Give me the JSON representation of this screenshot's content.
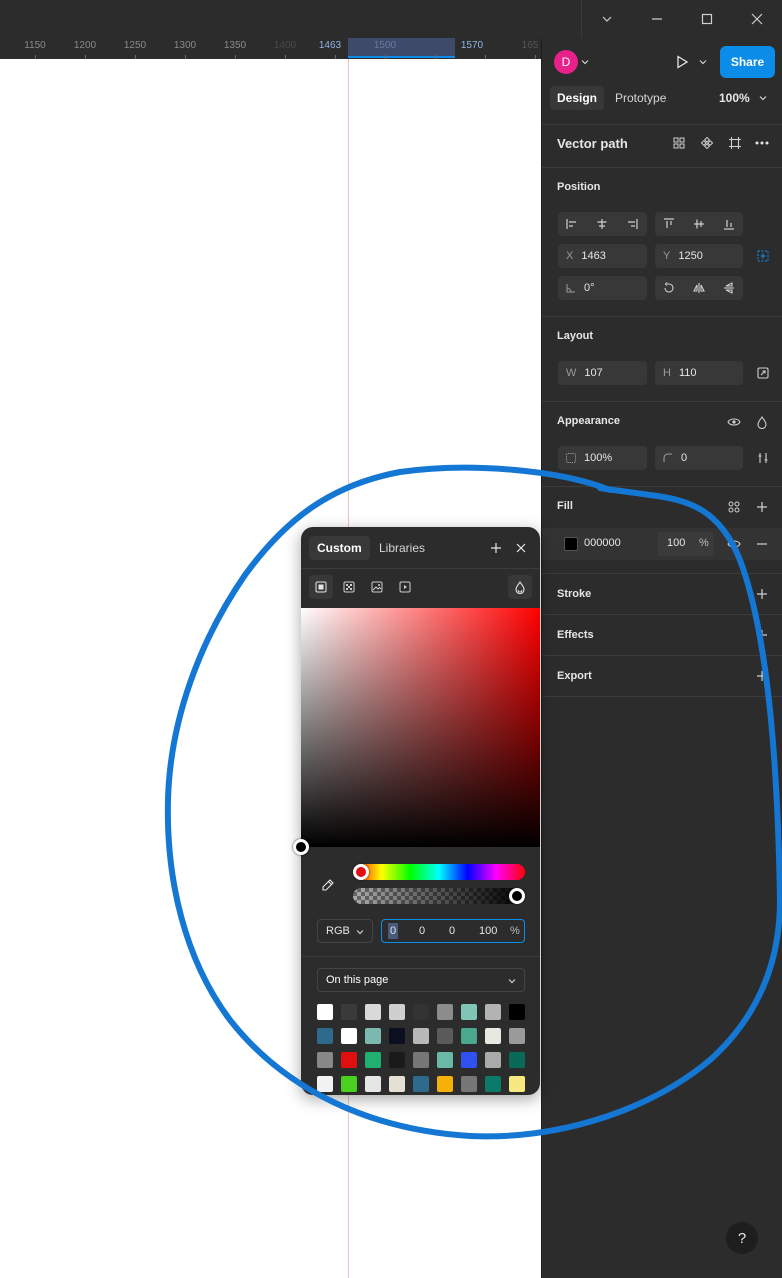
{
  "ruler": {
    "ticks": [
      "1150",
      "1200",
      "1250",
      "1300",
      "1350",
      "1400",
      "1463",
      "1500",
      "1570",
      "165"
    ],
    "sel_start": "1463",
    "sel_end": "1570"
  },
  "header": {
    "avatar_letter": "D",
    "share_label": "Share",
    "tabs": [
      "Design",
      "Prototype"
    ],
    "zoom": "100%"
  },
  "layer": {
    "name": "Vector path"
  },
  "position": {
    "title": "Position",
    "x_label": "X",
    "x": "1463",
    "y_label": "Y",
    "y": "1250",
    "rotation": "0°"
  },
  "layout": {
    "title": "Layout",
    "w_label": "W",
    "w": "107",
    "h_label": "H",
    "h": "110"
  },
  "appearance": {
    "title": "Appearance",
    "opacity": "100%",
    "radius": "0"
  },
  "fill": {
    "title": "Fill",
    "hex": "000000",
    "opacity": "100",
    "percent": "%"
  },
  "sections": {
    "stroke": "Stroke",
    "effects": "Effects",
    "export": "Export"
  },
  "help": "?",
  "picker": {
    "tabs": [
      "Custom",
      "Libraries"
    ],
    "mode": "RGB",
    "r": "0",
    "g": "0",
    "b": "0",
    "a": "100",
    "percent": "%",
    "page_select": "On this page",
    "swatches": [
      [
        "#ffffff",
        "#3a3a3a",
        "#d9d9d9",
        "#cfcfcf",
        "#333333",
        "#8c8c8c",
        "#7fc6b7",
        "#b3b3b3",
        "#000000"
      ],
      [
        "#2d6a8e",
        "#ffffff",
        "#7ab8b0",
        "#0b0f1e",
        "#b8b8b8",
        "#5a5a5a",
        "#4aa88c",
        "#e8e8e0",
        "#9a9a9a"
      ],
      [
        "#888888",
        "#e01010",
        "#20b070",
        "#1a1a1a",
        "#777777",
        "#6ab8a8",
        "#3050f0",
        "#aaaaaa",
        "#0a6a5a"
      ],
      [
        "#f2f2f2",
        "#4ad020",
        "#e6e6e6",
        "#e4e0d4",
        "#2d6a8e",
        "#f5b00a",
        "#777777",
        "#0a7a6a",
        "#f8e880"
      ]
    ]
  },
  "colors": {
    "accent": "#0c8ce9",
    "panel": "#2c2c2c",
    "annotation": "#1477d4",
    "avatar": "#e8208a"
  }
}
